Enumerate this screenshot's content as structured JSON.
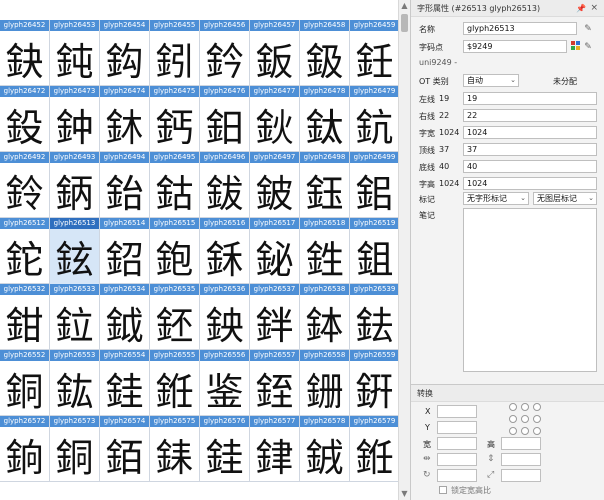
{
  "grid": {
    "selected": "glyph26513",
    "rows": [
      {
        "labels": [
          "glyph26452",
          "glyph26453",
          "glyph26454",
          "glyph26455",
          "glyph26456",
          "glyph26457",
          "glyph26458",
          "glyph26459"
        ],
        "chars": [
          "鈌",
          "鈍",
          "鈎",
          "鈏",
          "鈐",
          "鈑",
          "鈒",
          "鈓"
        ]
      },
      {
        "labels": [
          "glyph26472",
          "glyph26473",
          "glyph26474",
          "glyph26475",
          "glyph26476",
          "glyph26477",
          "glyph26478",
          "glyph26479"
        ],
        "chars": [
          "鈠",
          "鈡",
          "鈢",
          "鈣",
          "鈤",
          "鈥",
          "鈦",
          "鈧"
        ]
      },
      {
        "labels": [
          "glyph26492",
          "glyph26493",
          "glyph26494",
          "glyph26495",
          "glyph26496",
          "glyph26497",
          "glyph26498",
          "glyph26499"
        ],
        "chars": [
          "鈴",
          "鈵",
          "鈶",
          "鈷",
          "鈸",
          "鈹",
          "鈺",
          "鈻"
        ]
      },
      {
        "labels": [
          "glyph26512",
          "glyph26513",
          "glyph26514",
          "glyph26515",
          "glyph26516",
          "glyph26517",
          "glyph26518",
          "glyph26519"
        ],
        "chars": [
          "鉈",
          "鉉",
          "鉊",
          "鉋",
          "鉌",
          "鉍",
          "鉎",
          "鉏"
        ]
      },
      {
        "labels": [
          "glyph26532",
          "glyph26533",
          "glyph26534",
          "glyph26535",
          "glyph26536",
          "glyph26537",
          "glyph26538",
          "glyph26539"
        ],
        "chars": [
          "鉗",
          "鉝",
          "鉞",
          "鉟",
          "鉠",
          "鉡",
          "鉢",
          "鉣"
        ]
      },
      {
        "labels": [
          "glyph26552",
          "glyph26553",
          "glyph26554",
          "glyph26555",
          "glyph26556",
          "glyph26557",
          "glyph26558",
          "glyph26559"
        ],
        "chars": [
          "銅",
          "鈜",
          "銈",
          "銋",
          "鉴",
          "銍",
          "銏",
          "銒"
        ]
      },
      {
        "labels": [
          "glyph26572",
          "glyph26573",
          "glyph26574",
          "glyph26575",
          "glyph26576",
          "glyph26577",
          "glyph26578",
          "glyph26579"
        ],
        "chars": [
          "銄",
          "銅",
          "銆",
          "銇",
          "銈",
          "銉",
          "銊",
          "銋"
        ]
      }
    ]
  },
  "panel": {
    "title": "字形属性 (#26513 glyph26513)",
    "name_label": "名称",
    "name_value": "glyph26513",
    "codepoint_label": "字码点",
    "codepoint_value": "$9249",
    "uni_label": "uni9249 -",
    "ot_label": "OT 类别",
    "ot_value": "自动",
    "unassigned": "未分配",
    "metrics": [
      {
        "label": "左线",
        "orig": "19",
        "value": "19"
      },
      {
        "label": "右线",
        "orig": "22",
        "value": "22"
      },
      {
        "label": "字宽",
        "orig": "1024",
        "value": "1024"
      },
      {
        "label": "顶线",
        "orig": "37",
        "value": "37"
      },
      {
        "label": "底线",
        "orig": "40",
        "value": "40"
      },
      {
        "label": "字高",
        "orig": "1024",
        "value": "1024"
      }
    ],
    "mark_label": "标记",
    "mark_value1": "无字形标记",
    "mark_value2": "无图层标记",
    "notes_label": "笔记"
  },
  "transform": {
    "title": "转换",
    "x_label": "X",
    "y_label": "Y",
    "w_label": "宽",
    "h_label": "高",
    "lock_label": "锁定宽高比"
  },
  "colors": {
    "header_blue": "#4d8fd6",
    "selected_bg": "#d6e6f7"
  }
}
